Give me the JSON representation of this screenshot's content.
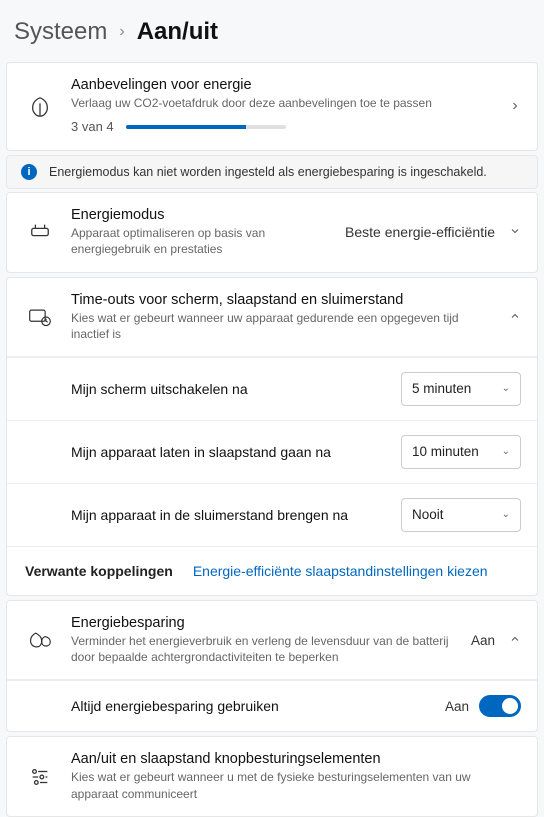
{
  "breadcrumb": {
    "parent": "Systeem",
    "current": "Aan/uit"
  },
  "recommend": {
    "title": "Aanbevelingen voor energie",
    "subtitle": "Verlaag uw CO2-voetafdruk door deze aanbevelingen toe te passen",
    "progress_text": "3 van 4",
    "progress_percent": 75
  },
  "info_bar": {
    "text": "Energiemodus kan niet worden ingesteld als energiebesparing is ingeschakeld."
  },
  "power_mode": {
    "title": "Energiemodus",
    "subtitle": "Apparaat optimaliseren op basis van energiegebruik en prestaties",
    "value": "Beste energie-efficiëntie"
  },
  "timeouts": {
    "title": "Time-outs voor scherm, slaapstand en sluimerstand",
    "subtitle": "Kies wat er gebeurt wanneer uw apparaat gedurende een opgegeven tijd inactief is",
    "items": [
      {
        "label": "Mijn scherm uitschakelen na",
        "value": "5 minuten"
      },
      {
        "label": "Mijn apparaat laten in slaapstand gaan na",
        "value": "10 minuten"
      },
      {
        "label": "Mijn apparaat in de sluimerstand brengen na",
        "value": "Nooit"
      }
    ],
    "related_label": "Verwante koppelingen",
    "related_link": "Energie-efficiënte slaapstandinstellingen kiezen"
  },
  "battery_saver": {
    "title": "Energiebesparing",
    "subtitle": "Verminder het energieverbruik en verleng de levensduur van de batterij door bepaalde achtergrondactiviteiten te beperken",
    "status": "Aan",
    "always": {
      "label": "Altijd energiebesparing gebruiken",
      "value": "Aan"
    }
  },
  "buttons": {
    "title": "Aan/uit en slaapstand knopbesturingselementen",
    "subtitle": "Kies wat er gebeurt wanneer u met de fysieke besturingselementen van uw apparaat communiceert"
  }
}
